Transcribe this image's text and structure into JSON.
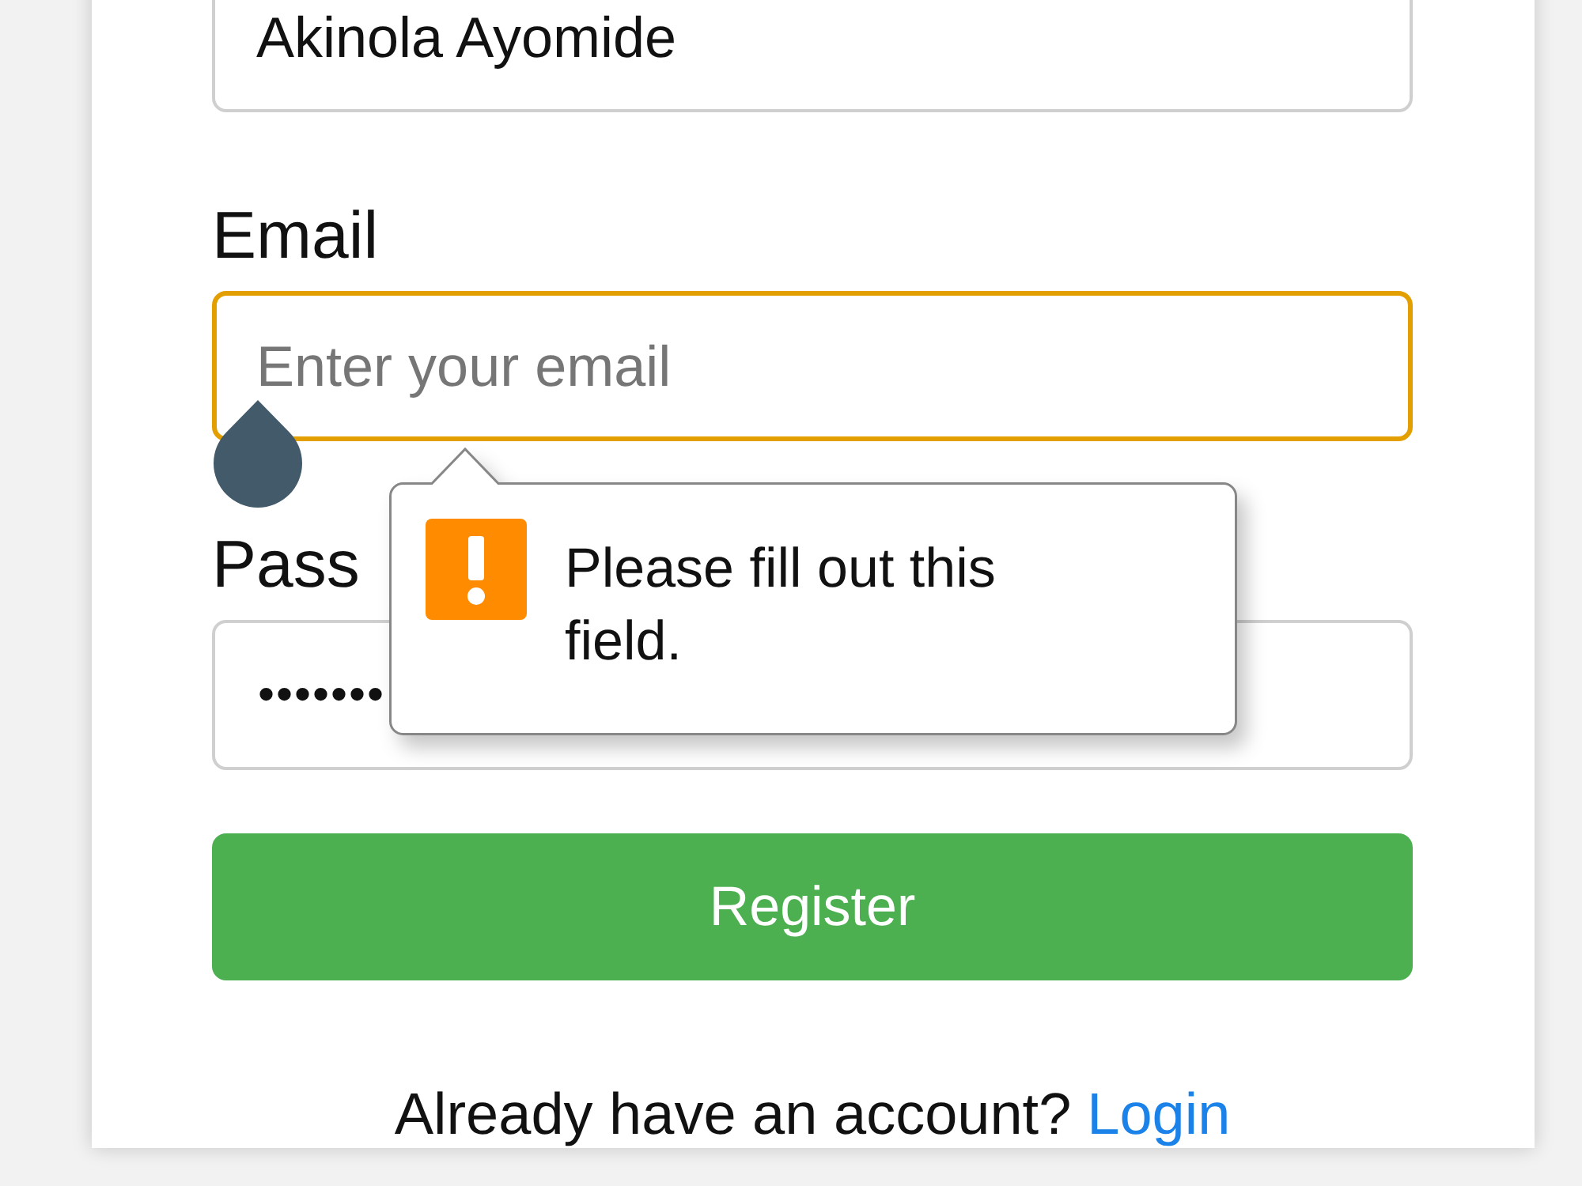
{
  "form": {
    "fields": [
      {
        "kind": "text",
        "value": "Akinola Ayomide",
        "focused": false
      },
      {
        "kind": "email",
        "label": "Email",
        "placeholder": "Enter your email",
        "focused": true,
        "message": "Please fill out this field."
      },
      {
        "kind": "password",
        "label": "Pass",
        "value": "•••••••",
        "focused": false
      }
    ],
    "submit": {
      "label": "Register"
    }
  },
  "footer": {
    "text": "Already have an account?",
    "link": "Login"
  }
}
